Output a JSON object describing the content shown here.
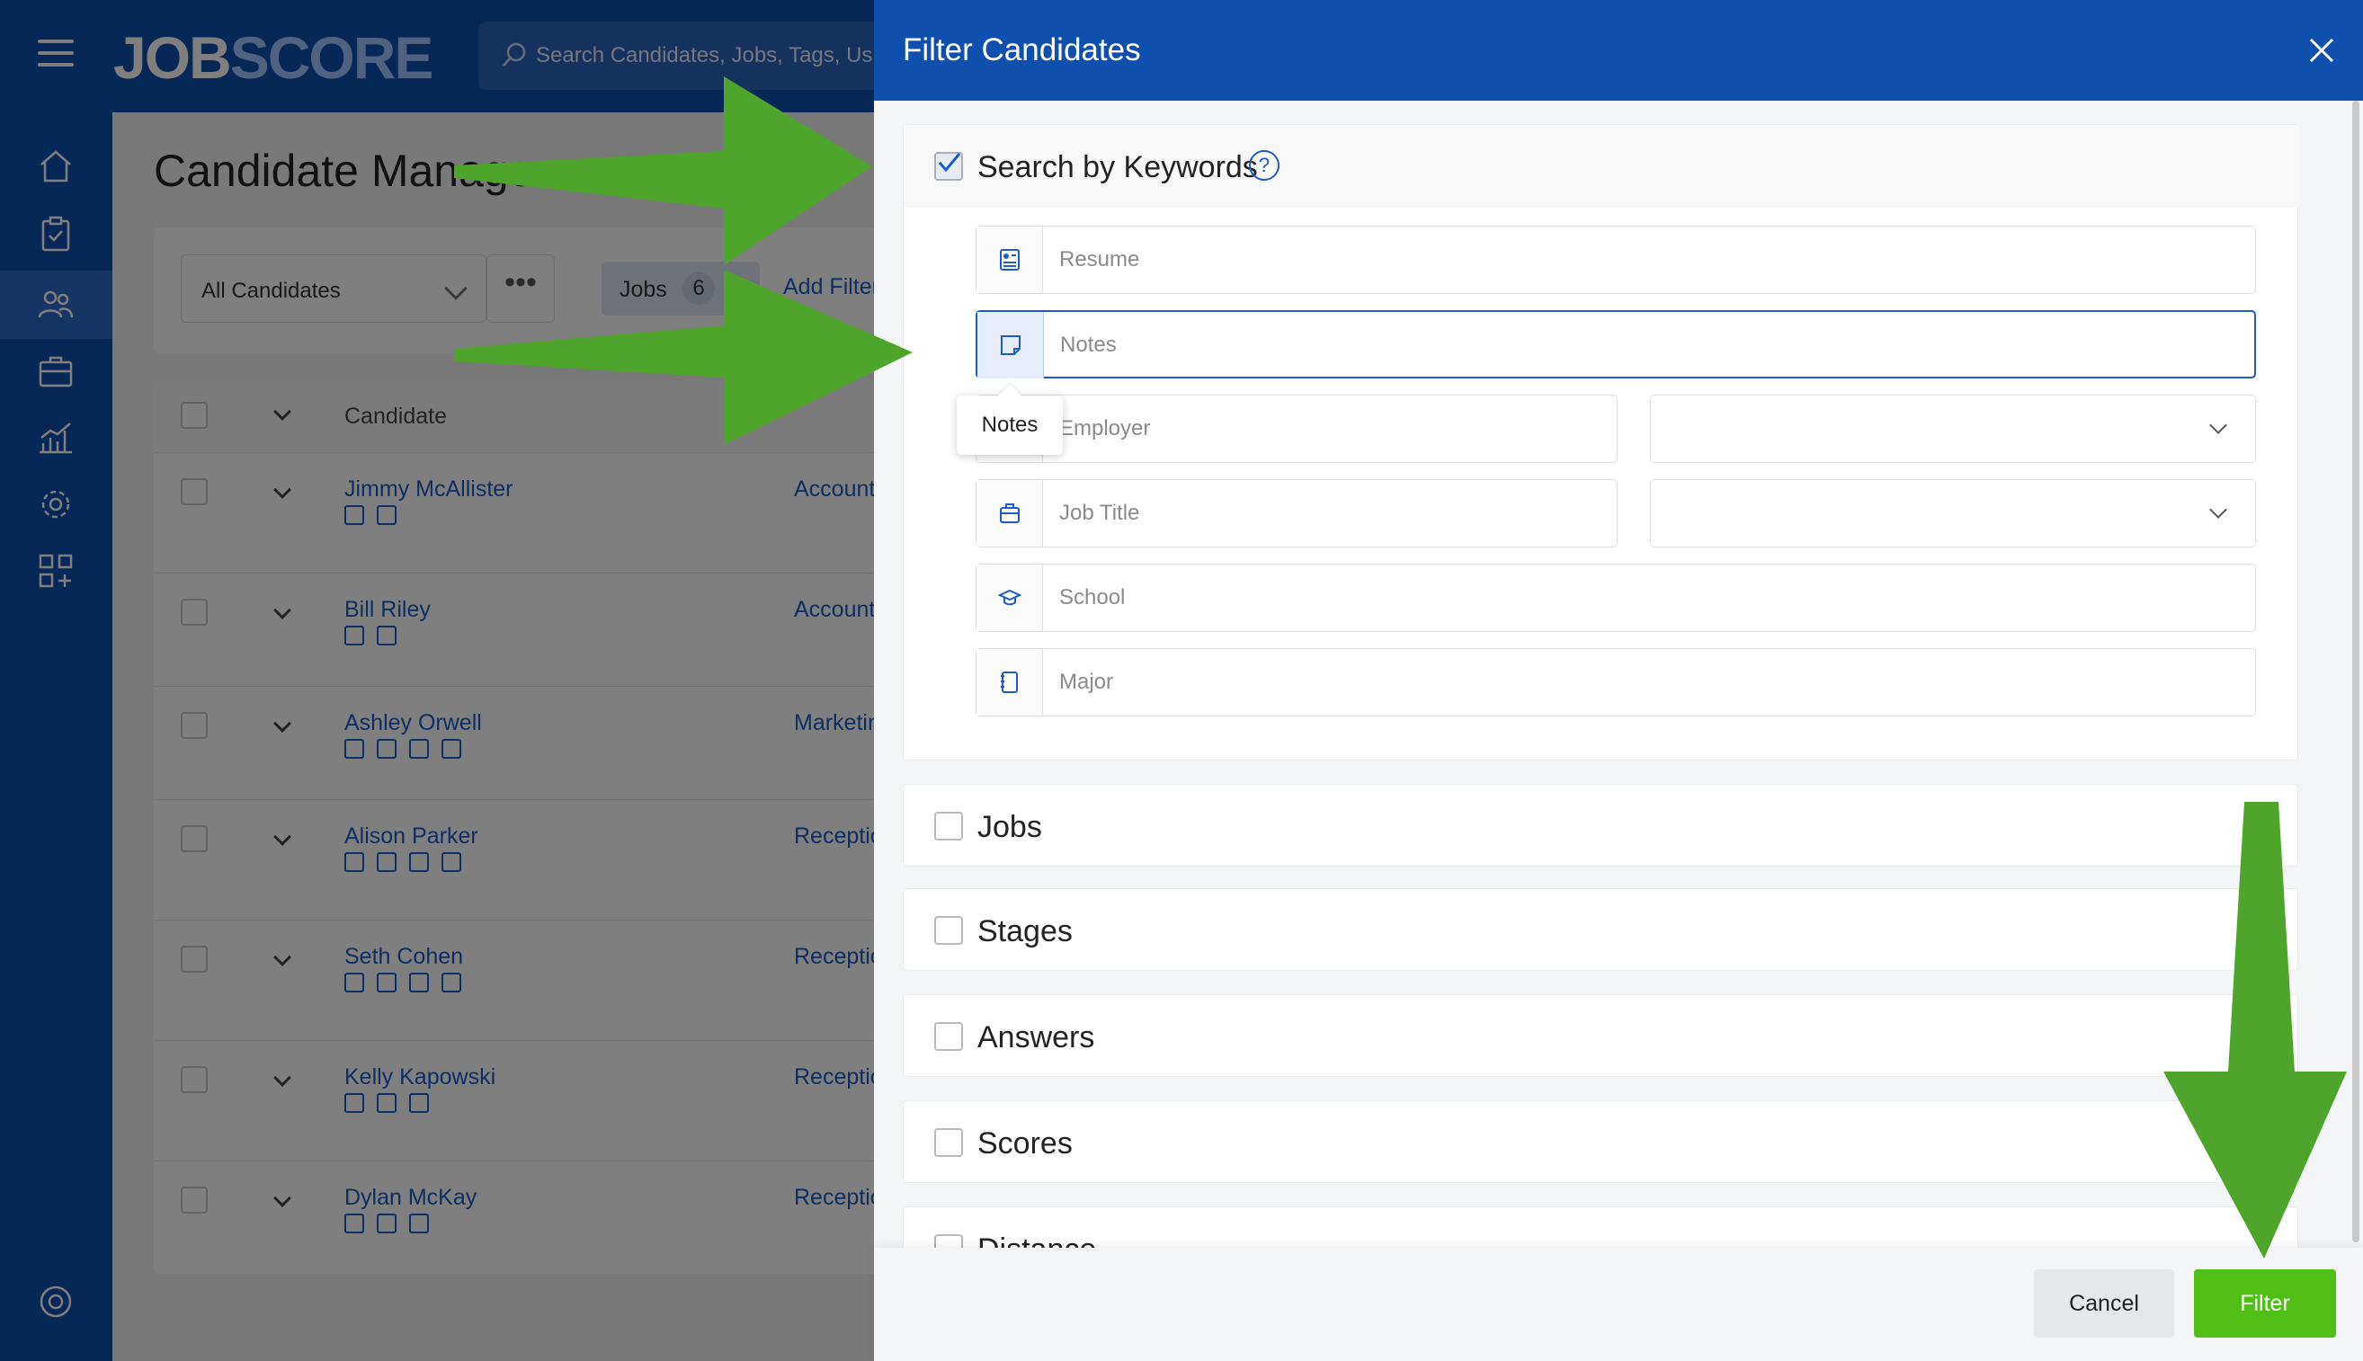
{
  "app": {
    "logo_part1": "JOB",
    "logo_part2": "SCORE",
    "search_placeholder": "Search Candidates, Jobs, Tags, Us"
  },
  "nav": {
    "icons": [
      "home-icon",
      "tasks-icon",
      "candidates-icon",
      "jobs-icon",
      "reports-icon",
      "settings-icon",
      "apps-icon",
      "help-icon"
    ]
  },
  "page": {
    "title": "Candidate Manager",
    "filter_select": "All Candidates",
    "more": "•••",
    "chip_label": "Jobs",
    "chip_count": "6",
    "chip_remove": "✕",
    "add_filter": "Add Filter",
    "col_candidate": "Candidate"
  },
  "candidates": [
    {
      "name": "Jimmy McAllister",
      "job": "Account Exe",
      "icons": 2
    },
    {
      "name": "Bill Riley",
      "job": "Account Exe",
      "icons": 2
    },
    {
      "name": "Ashley Orwell",
      "job": "Marketing M",
      "icons": 4
    },
    {
      "name": "Alison Parker",
      "job": "Receptionist",
      "icons": 4
    },
    {
      "name": "Seth Cohen",
      "job": "Receptionist",
      "icons": 4
    },
    {
      "name": "Kelly Kapowski",
      "job": "Receptionist",
      "icons": 3
    },
    {
      "name": "Dylan McKay",
      "job": "Receptionist",
      "icons": 3
    }
  ],
  "modal": {
    "title": "Filter Candidates",
    "close": "close",
    "keywords": {
      "label": "Search by Keywords",
      "checked": true,
      "help": "?",
      "fields": {
        "resume": "Resume",
        "notes": "Notes",
        "employer": "Employer",
        "job_title": "Job Title",
        "school": "School",
        "major": "Major"
      },
      "tooltip": "Notes"
    },
    "sections": {
      "jobs": "Jobs",
      "stages": "Stages",
      "answers": "Answers",
      "scores": "Scores",
      "distance": "Distance"
    },
    "buttons": {
      "cancel": "Cancel",
      "filter": "Filter"
    }
  },
  "colors": {
    "brand_blue": "#0f4fae",
    "accent_green": "#4fbf16",
    "link_blue": "#1c5cc4",
    "annotation_arrow": "#4fa52b"
  }
}
